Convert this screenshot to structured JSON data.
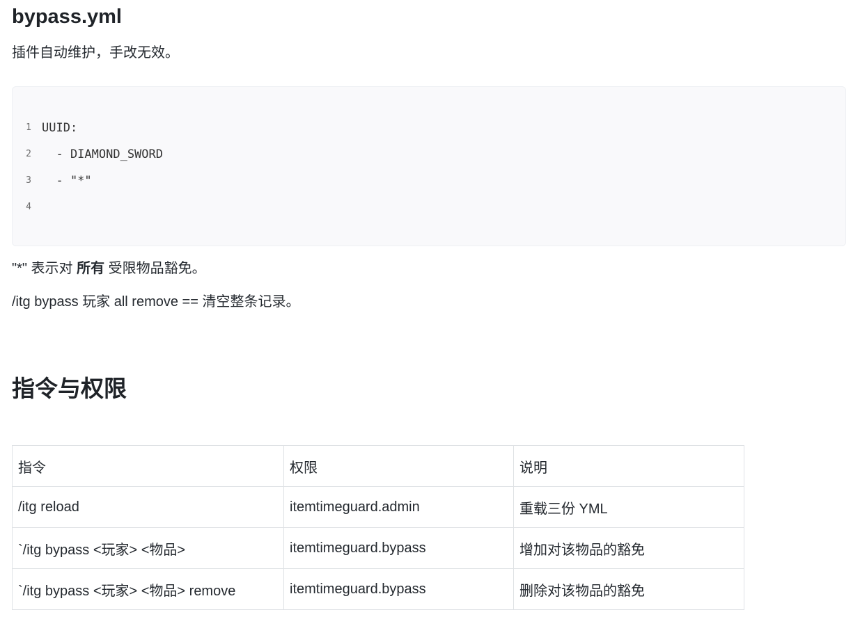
{
  "file_section": {
    "title": "bypass.yml",
    "description": "插件自动维护，手改无效。"
  },
  "code_block": {
    "language": "yaml",
    "lines": [
      {
        "num": "1",
        "text": "UUID:"
      },
      {
        "num": "2",
        "text": "  - DIAMOND_SWORD"
      },
      {
        "num": "3",
        "text": "  - \"*\""
      },
      {
        "num": "4",
        "text": ""
      }
    ]
  },
  "notes": {
    "wildcard_prefix": "\"*\" 表示对 ",
    "wildcard_bold": "所有",
    "wildcard_suffix": " 受限物品豁免。",
    "remove_all": "/itg bypass 玩家 all remove == 清空整条记录。"
  },
  "commands_section": {
    "title": "指令与权限",
    "table": {
      "headers": [
        "指令",
        "权限",
        "说明"
      ],
      "rows": [
        [
          "/itg reload",
          "itemtimeguard.admin",
          "重载三份 YML"
        ],
        [
          "`/itg bypass <玩家> <物品>",
          "itemtimeguard.bypass",
          "增加对该物品的豁免"
        ],
        [
          "`/itg bypass <玩家> <物品> remove",
          "itemtimeguard.bypass",
          "删除对该物品的豁免"
        ]
      ]
    }
  }
}
